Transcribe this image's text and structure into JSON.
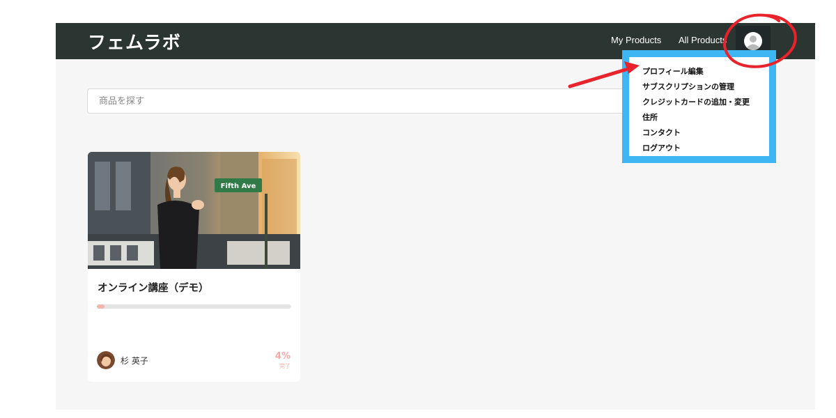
{
  "header": {
    "brand": "フェムラボ",
    "nav": [
      "My Products",
      "All Products"
    ]
  },
  "search": {
    "placeholder": "商品を探す"
  },
  "course_card": {
    "title": "オンライン講座（デモ）",
    "image_sign_text": "Fifth Ave",
    "progress_fraction": 0.04,
    "author": "杉 英子",
    "percent_text": "4%",
    "percent_label": "完了"
  },
  "user_menu": {
    "items": [
      "プロフィール編集",
      "サブスクリプションの管理",
      "クレジットカードの追加・変更",
      "住所",
      "コンタクト",
      "ログアウト"
    ]
  },
  "colors": {
    "topbar": "#2b3532",
    "page_background": "#f6f6f6",
    "highlight_box": "#3fb6f4",
    "annotation_red": "#e8232c",
    "progress_fill": "#f3b3ae"
  },
  "icons": [
    "user-avatar-icon",
    "author-avatar",
    "red-arrow-annotation",
    "red-circle-annotation"
  ]
}
